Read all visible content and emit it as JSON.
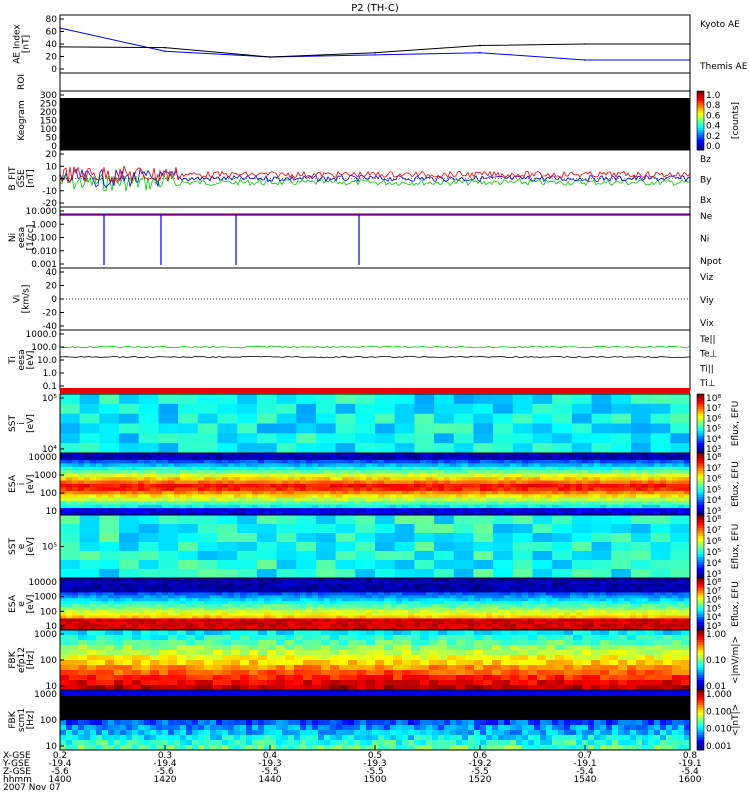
{
  "title": "P2 (TH-C)",
  "colors": {
    "blue": "#0000ee",
    "red": "#ee0000",
    "green": "#00cc00",
    "black": "#000000"
  },
  "panels": [
    {
      "id": "ae",
      "ylabel": [
        "AE Index",
        "[nT]"
      ],
      "ticks": [
        "80",
        "60",
        "40",
        "20",
        "0"
      ],
      "legend": [
        {
          "text": "Kyoto AE",
          "color": "blue"
        },
        {
          "text": "Themis AE",
          "color": "black"
        }
      ]
    },
    {
      "id": "roi",
      "ylabel": [
        "ROI"
      ],
      "ticks": []
    },
    {
      "id": "kgram",
      "ylabel": [
        "Keogram"
      ],
      "ticks": [
        "300",
        "250",
        "200",
        "150",
        "100",
        "50",
        "0"
      ],
      "colorbar": {
        "ticks": [
          "1.0",
          "0.8",
          "0.6",
          "0.4",
          "0.2",
          "0.0"
        ],
        "label": "[counts]"
      }
    },
    {
      "id": "bfit",
      "ylabel": [
        "B_FIT",
        "GSE",
        "[nT]"
      ],
      "ticks": [
        "20",
        "10",
        "0",
        "-10",
        "-20"
      ],
      "legend": [
        {
          "text": "Bz",
          "color": "red"
        },
        {
          "text": "By",
          "color": "green"
        },
        {
          "text": "Bx",
          "color": "blue"
        }
      ]
    },
    {
      "id": "ni",
      "ylabel": [
        "Ni",
        "eesa",
        "[1/cc]"
      ],
      "ticks": [
        "10.000",
        "1.000",
        "0.100",
        "0.010",
        "0.001"
      ],
      "legend": [
        {
          "text": "Ne",
          "color": "red"
        },
        {
          "text": "Ni",
          "color": "black"
        },
        {
          "text": "Npot",
          "color": "blue"
        }
      ]
    },
    {
      "id": "vi",
      "ylabel": [
        "Vi",
        "[km/s]"
      ],
      "ticks": [
        "40",
        "20",
        "0",
        "-20",
        "-40"
      ],
      "legend": [
        {
          "text": "Viz",
          "color": "red"
        },
        {
          "text": "Viy",
          "color": "green"
        },
        {
          "text": "Vix",
          "color": "blue"
        }
      ]
    },
    {
      "id": "ti",
      "ylabel": [
        "Ti",
        "eesa",
        "[eV]"
      ],
      "ticks": [
        "1000.0",
        "100.0",
        "10.0",
        "1.0",
        "0.1"
      ],
      "legend": [
        {
          "text": "Te||",
          "color": "black"
        },
        {
          "text": "Te⊥",
          "color": "red"
        },
        {
          "text": "Ti||",
          "color": "green"
        },
        {
          "text": "Ti⊥",
          "color": "blue"
        }
      ]
    },
    {
      "id": "sst1",
      "ylabel": [
        "SST",
        "i",
        "[eV]"
      ],
      "ticks": [
        "10⁵",
        "10⁴"
      ],
      "colorbar": {
        "ticks": [
          "10⁸",
          "10⁷",
          "10⁶",
          "10⁵",
          "10⁴",
          "10³"
        ],
        "label": "Eflux, EFU"
      }
    },
    {
      "id": "esa1",
      "ylabel": [
        "ESA",
        "i",
        "[eV]"
      ],
      "ticks": [
        "10000",
        "1000",
        "100",
        "10"
      ],
      "colorbar": {
        "ticks": [
          "10⁸",
          "10⁷",
          "10⁶",
          "10⁵",
          "10⁴",
          "10³"
        ],
        "label": "Eflux, EFU"
      }
    },
    {
      "id": "sst2",
      "ylabel": [
        "SST",
        "e",
        "[eV]"
      ],
      "ticks": [
        "10⁵"
      ],
      "colorbar": {
        "ticks": [
          "10⁸",
          "10⁷",
          "10⁶",
          "10⁵",
          "10⁴",
          "10³"
        ],
        "label": "Eflux, EFU"
      }
    },
    {
      "id": "esa2",
      "ylabel": [
        "ESA",
        "e",
        "[eV]"
      ],
      "ticks": [
        "10000",
        "1000",
        "100",
        "10"
      ],
      "colorbar": {
        "ticks": [
          "10⁸",
          "10⁷",
          "10⁶",
          "10⁵",
          "10⁴",
          "10³"
        ],
        "label": "Eflux, EFU"
      }
    },
    {
      "id": "fbk1",
      "ylabel": [
        "FBK",
        "efp12",
        "[Hz]"
      ],
      "ticks": [
        "1000",
        "100",
        "10"
      ],
      "colorbar": {
        "ticks": [
          "1.00",
          "0.10",
          "0.01"
        ],
        "label": "<|mV/m|>"
      }
    },
    {
      "id": "fbk2",
      "ylabel": [
        "FBK",
        "scm1",
        "[Hz]"
      ],
      "ticks": [
        "1000",
        "100",
        "10"
      ],
      "colorbar": {
        "ticks": [
          "1.000",
          "0.100",
          "0.010",
          "0.001"
        ],
        "label": "<|nT|>"
      }
    }
  ],
  "xaxis": {
    "row_labels": [
      "X-GSE",
      "Y-GSE",
      "Z-GSE",
      "hhmm",
      "2007 Nov 07"
    ],
    "ticks": [
      {
        "x": "0.2",
        "y": "-19.4",
        "z": "-5.6",
        "t": "1400"
      },
      {
        "x": "0.3",
        "y": "-19.4",
        "z": "-5.6",
        "t": "1420"
      },
      {
        "x": "0.4",
        "y": "-19.3",
        "z": "-5.5",
        "t": "1440"
      },
      {
        "x": "0.5",
        "y": "-19.3",
        "z": "-5.5",
        "t": "1500"
      },
      {
        "x": "0.6",
        "y": "-19.2",
        "z": "-5.5",
        "t": "1520"
      },
      {
        "x": "0.7",
        "y": "-19.1",
        "z": "-5.4",
        "t": "1540"
      },
      {
        "x": "0.8",
        "y": "-19.1",
        "z": "-5.4",
        "t": "1600"
      }
    ]
  },
  "chart_data": {
    "type": "line",
    "title": "P2 (TH-C)",
    "x": [
      "1400",
      "1420",
      "1440",
      "1500",
      "1520",
      "1540",
      "1600"
    ],
    "series": [
      {
        "name": "Kyoto AE",
        "values": [
          62,
          30,
          22,
          25,
          28,
          18,
          18
        ]
      },
      {
        "name": "Themis AE",
        "values": [
          36,
          35,
          22,
          28,
          38,
          40,
          40
        ]
      }
    ],
    "xlabel": "hhmm",
    "ylabel": "AE Index [nT]",
    "ylim": [
      0,
      80
    ]
  }
}
